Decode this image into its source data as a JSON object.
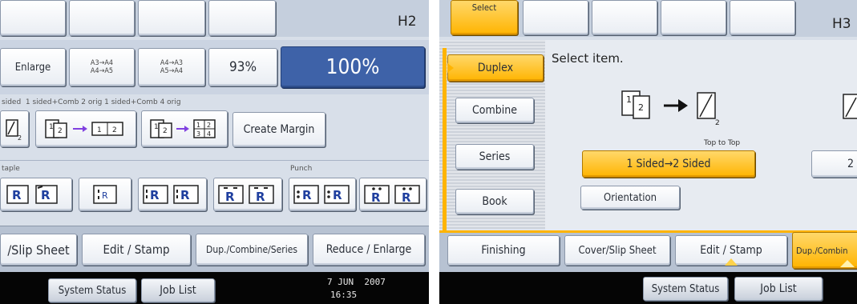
{
  "left": {
    "screen_id": "H2",
    "reduce_buttons": {
      "enlarge": "Enlarge",
      "a3a4_top": "A3→A4",
      "a3a4_bottom": "A4→A5",
      "a4a3_top": "A4→A3",
      "a4a3_bottom": "A5→A4",
      "pct93": "93%",
      "pct100": "100%"
    },
    "sided_labels": "sided  1 sided+Comb 2 orig 1 sided+Comb 4 orig",
    "create_margin": "Create Margin",
    "staple_label": "taple",
    "punch_label": "Punch",
    "tabs": {
      "slip_sheet": "/Slip Sheet",
      "edit_stamp": "Edit / Stamp",
      "dup_combine": "Dup./Combine/Series",
      "reduce_enlarge": "Reduce / Enlarge"
    },
    "status_bar": {
      "system_status": "System Status",
      "job_list": "Job List",
      "date": "7 JUN  2007",
      "time": "16:35"
    }
  },
  "right": {
    "screen_id": "H3",
    "select_tab": "Select",
    "side_menu": {
      "duplex": "Duplex",
      "combine": "Combine",
      "series": "Series",
      "book": "Book"
    },
    "select_item": "Select item.",
    "top_to_top": "Top to Top",
    "one_to_two": "1 Sided→2 Sided",
    "two_partial": "2",
    "orientation": "Orientation",
    "tabs": {
      "finishing": "Finishing",
      "cover_slip": "Cover/Slip Sheet",
      "edit_stamp": "Edit / Stamp",
      "dup_combine": "Dup./Combin"
    },
    "status_bar": {
      "system_status": "System Status",
      "job_list": "Job List"
    }
  },
  "colors": {
    "selected_blue": "#3e62a8",
    "orange": "#ffb400",
    "panel_bg": "#d6dde8",
    "status_bar": "#050505"
  }
}
